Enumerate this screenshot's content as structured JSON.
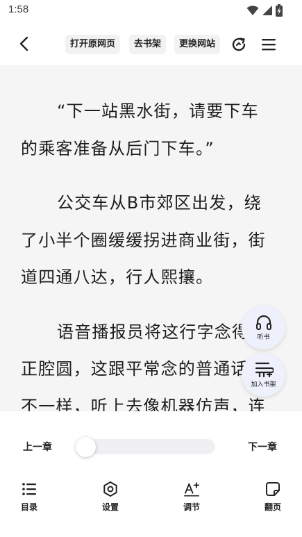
{
  "status_bar": {
    "time": "1:58",
    "icons": [
      "wifi-icon",
      "signal-icon",
      "battery-charging-icon"
    ]
  },
  "toolbar": {
    "back_icon": "chevron-left-icon",
    "open_original_label": "打开原网页",
    "go_shelf_label": "去书架",
    "change_source_label": "更换网站",
    "refresh_icon": "refresh-icon",
    "menu_icon": "hamburger-menu-icon"
  },
  "content": {
    "paragraphs": [
      {
        "lines": [
          "“下一站黑水街，请要下车",
          "的乘客准备从后门下车。”"
        ]
      },
      {
        "lines": [
          "公交车从B市郊区出发，绕",
          "了小半个圈缓缓拐进商业街，街",
          "道四通八达，行人熙攘。"
        ]
      },
      {
        "lines": [
          "语音播报员将这行字念得",
          "正腔圆，这跟平常念的普通话",
          "不一样，听上去像机器仿声，连"
        ]
      }
    ]
  },
  "fabs": {
    "listen_label": "听书",
    "add_shelf_label": "加入书架"
  },
  "chapter_nav": {
    "prev_label": "上一章",
    "next_label": "下一章",
    "progress": 0.0
  },
  "bottom_nav": {
    "toc_label": "目录",
    "settings_label": "设置",
    "adjust_label": "调节",
    "page_turn_label": "翻页"
  },
  "colors": {
    "reading_background": "#f5f5f5",
    "chip_background": "#f2f2f2",
    "fab_background": "#eef1fb",
    "text": "#1c1c1c"
  }
}
